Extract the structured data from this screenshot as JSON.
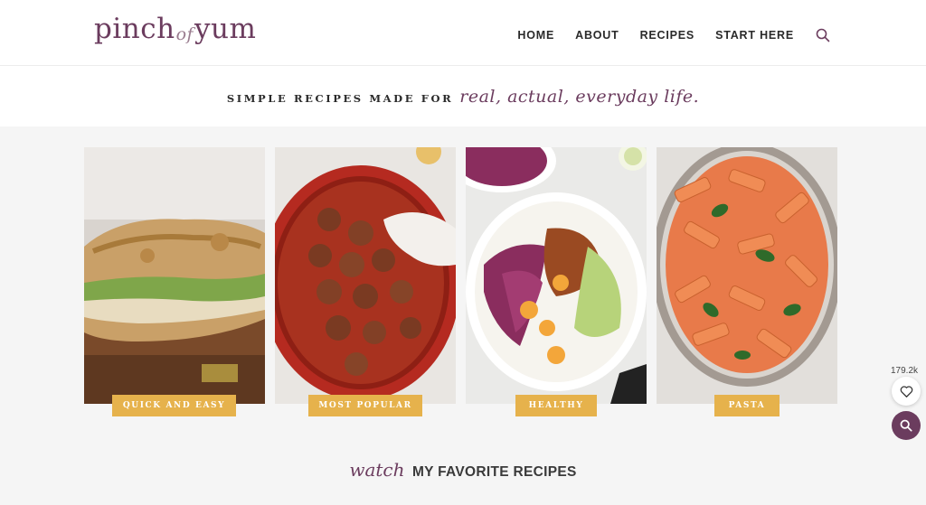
{
  "header": {
    "logo": {
      "part1": "pinch",
      "part2": "of",
      "part3": "yum"
    },
    "nav": [
      "HOME",
      "ABOUT",
      "RECIPES",
      "START HERE"
    ],
    "search_icon": "search-icon"
  },
  "tagline": {
    "plain": "SIMPLE RECIPES MADE FOR",
    "script": "real, actual, everyday life."
  },
  "categories": [
    {
      "label": "QUICK AND EASY"
    },
    {
      "label": "MOST POPULAR"
    },
    {
      "label": "HEALTHY"
    },
    {
      "label": "PASTA"
    }
  ],
  "watch": {
    "script": "watch",
    "bold": "MY FAVORITE RECIPES"
  },
  "floating": {
    "fav_count": "179.2k",
    "fav_icon": "heart-icon",
    "search_icon": "search-icon"
  },
  "colors": {
    "brand": "#6b3c5e",
    "label_bg": "#e6b24c"
  }
}
